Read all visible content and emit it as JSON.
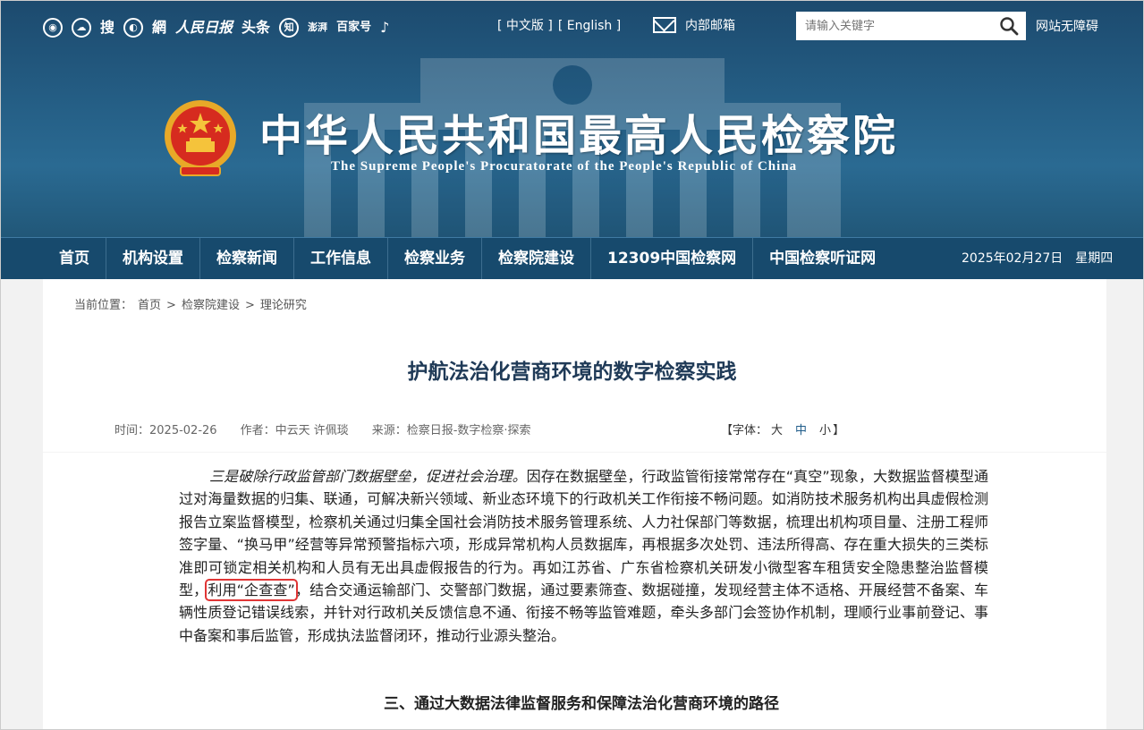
{
  "header": {
    "social_icons": [
      "weibo-icon",
      "wechat-icon",
      "sohu-icon",
      "qq-icon",
      "netease-icon",
      "peoples-daily-icon",
      "toutiao-icon",
      "zhihu-icon",
      "thepaper-icon",
      "baijiahao-icon",
      "tiktok-icon"
    ],
    "social_labels": [
      "搜",
      "網",
      "人民日报",
      "头条",
      "知",
      "澎湃",
      "百家号"
    ],
    "lang_cn": "[ 中文版 ]",
    "lang_en": "[ English ]",
    "mail_label": "内部邮箱",
    "search_placeholder": "请输入关键字",
    "accessibility": "网站无障碍",
    "site_title": "中华人民共和国最高人民检察院",
    "site_subtitle": "The Supreme People's Procuratorate of the People's Republic of China"
  },
  "nav": {
    "items": [
      "首页",
      "机构设置",
      "检察新闻",
      "工作信息",
      "检察业务",
      "检察院建设",
      "12309中国检察网",
      "中国检察听证网"
    ],
    "date": "2025年02月27日",
    "weekday": "星期四"
  },
  "breadcrumb": {
    "prefix": "当前位置：",
    "items": [
      "首页",
      ">",
      "检察院建设",
      ">",
      "理论研究"
    ]
  },
  "article": {
    "title": "护航法治化营商环境的数字检察实践",
    "time": "时间：2025-02-26",
    "author": "作者：中云天 许佩琰",
    "source": "来源：检察日报-数字检察·探索",
    "font_label": "【字体：",
    "font_large": "大",
    "font_medium": "中",
    "font_small": "小",
    "font_end": "】",
    "para_lead": "三是破除行政监管部门数据壁垒，促进社会治理。",
    "para_part1": "因存在数据壁垒，行政监管衔接常常存在“真空”现象，大数据监督模型通过对海量数据的归集、联通，可解决新兴领域、新业态环境下的行政机关工作衔接不畅问题。如消防技术服务机构出具虚假检测报告立案监督模型，检察机关通过归集全国社会消防技术服务管理系统、人力社保部门等数据，梳理出机构项目量、注册工程师签字量、“换马甲”经营等异常预警指标六项，形成异常机构人员数据库，再根据多次处罚、违法所得高、存在重大损失的三类标准即可锁定相关机构和人员有无出具虚假报告的行为。再如江苏省、广东省检察机关研发小微型客车租赁安全隐患整治监督模型，",
    "para_highlight": "利用“企查查”",
    "para_part2": "，结合交通运输部门、交警部门数据，通过要素筛查、数据碰撞，发现经营主体不适格、开展经营不备案、车辆性质登记错误线索，并针对行政机关反馈信息不通、衔接不畅等监管难题，牵头多部门会签协作机制，理顺行业事前登记、事中备案和事后监管，形成执法监督闭环，推动行业源头整治。",
    "section_heading": "三、通过大数据法律监督服务和保障法治化营商环境的路径"
  }
}
